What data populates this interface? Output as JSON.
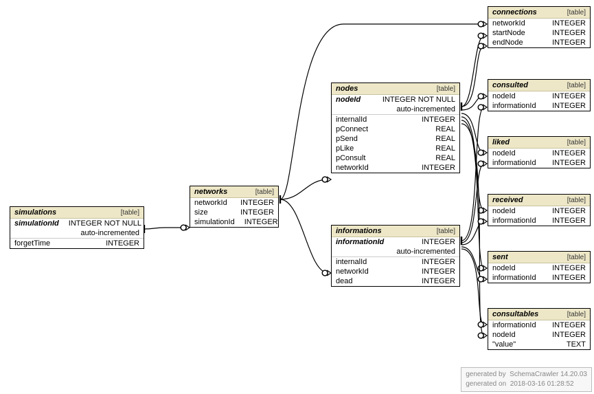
{
  "tables": {
    "simulations": {
      "name": "simulations",
      "tag": "[table]",
      "rows": [
        {
          "c1": "simulationId",
          "c2": "INTEGER NOT NULL",
          "pk": true
        },
        {
          "c1": "",
          "c2": "auto-incremented"
        },
        {
          "c1": "forgetTime",
          "c2": "INTEGER"
        }
      ]
    },
    "networks": {
      "name": "networks",
      "tag": "[table]",
      "rows": [
        {
          "c1": "networkId",
          "c2": "INTEGER"
        },
        {
          "c1": "size",
          "c2": "INTEGER"
        },
        {
          "c1": "simulationId",
          "c2": "INTEGER"
        }
      ]
    },
    "nodes": {
      "name": "nodes",
      "tag": "[table]",
      "rows": [
        {
          "c1": "nodeId",
          "c2": "INTEGER NOT NULL",
          "pk": true
        },
        {
          "c1": "",
          "c2": "auto-incremented"
        },
        {
          "c1": "internalId",
          "c2": "INTEGER"
        },
        {
          "c1": "pConnect",
          "c2": "REAL"
        },
        {
          "c1": "pSend",
          "c2": "REAL"
        },
        {
          "c1": "pLike",
          "c2": "REAL"
        },
        {
          "c1": "pConsult",
          "c2": "REAL"
        },
        {
          "c1": "networkId",
          "c2": "INTEGER"
        }
      ]
    },
    "informations": {
      "name": "informations",
      "tag": "[table]",
      "rows": [
        {
          "c1": "informationId",
          "c2": "INTEGER",
          "pk": true
        },
        {
          "c1": "",
          "c2": "auto-incremented"
        },
        {
          "c1": "internalId",
          "c2": "INTEGER"
        },
        {
          "c1": "networkId",
          "c2": "INTEGER"
        },
        {
          "c1": "dead",
          "c2": "INTEGER"
        }
      ]
    },
    "connections": {
      "name": "connections",
      "tag": "[table]",
      "rows": [
        {
          "c1": "networkId",
          "c2": "INTEGER"
        },
        {
          "c1": "startNode",
          "c2": "INTEGER"
        },
        {
          "c1": "endNode",
          "c2": "INTEGER"
        }
      ]
    },
    "consulted": {
      "name": "consulted",
      "tag": "[table]",
      "rows": [
        {
          "c1": "nodeId",
          "c2": "INTEGER"
        },
        {
          "c1": "informationId",
          "c2": "INTEGER"
        }
      ]
    },
    "liked": {
      "name": "liked",
      "tag": "[table]",
      "rows": [
        {
          "c1": "nodeId",
          "c2": "INTEGER"
        },
        {
          "c1": "informationId",
          "c2": "INTEGER"
        }
      ]
    },
    "received": {
      "name": "received",
      "tag": "[table]",
      "rows": [
        {
          "c1": "nodeId",
          "c2": "INTEGER"
        },
        {
          "c1": "informationId",
          "c2": "INTEGER"
        }
      ]
    },
    "sent": {
      "name": "sent",
      "tag": "[table]",
      "rows": [
        {
          "c1": "nodeId",
          "c2": "INTEGER"
        },
        {
          "c1": "informationId",
          "c2": "INTEGER"
        }
      ]
    },
    "consultables": {
      "name": "consultables",
      "tag": "[table]",
      "rows": [
        {
          "c1": "informationId",
          "c2": "INTEGER"
        },
        {
          "c1": "nodeId",
          "c2": "INTEGER"
        },
        {
          "c1": "\"value\"",
          "c2": "TEXT"
        }
      ]
    }
  },
  "footer": {
    "line1a": "generated by",
    "line1b": "SchemaCrawler 14.20.03",
    "line2a": "generated on",
    "line2b": "2018-03-16 01:28:52"
  },
  "chart_data": {
    "type": "diagram",
    "description": "Entity-relationship diagram produced by SchemaCrawler",
    "entities": [
      {
        "name": "simulations",
        "columns": [
          "simulationId INTEGER NOT NULL auto-incremented",
          "forgetTime INTEGER"
        ]
      },
      {
        "name": "networks",
        "columns": [
          "networkId INTEGER",
          "size INTEGER",
          "simulationId INTEGER"
        ]
      },
      {
        "name": "nodes",
        "columns": [
          "nodeId INTEGER NOT NULL auto-incremented",
          "internalId INTEGER",
          "pConnect REAL",
          "pSend REAL",
          "pLike REAL",
          "pConsult REAL",
          "networkId INTEGER"
        ]
      },
      {
        "name": "informations",
        "columns": [
          "informationId INTEGER auto-incremented",
          "internalId INTEGER",
          "networkId INTEGER",
          "dead INTEGER"
        ]
      },
      {
        "name": "connections",
        "columns": [
          "networkId INTEGER",
          "startNode INTEGER",
          "endNode INTEGER"
        ]
      },
      {
        "name": "consulted",
        "columns": [
          "nodeId INTEGER",
          "informationId INTEGER"
        ]
      },
      {
        "name": "liked",
        "columns": [
          "nodeId INTEGER",
          "informationId INTEGER"
        ]
      },
      {
        "name": "received",
        "columns": [
          "nodeId INTEGER",
          "informationId INTEGER"
        ]
      },
      {
        "name": "sent",
        "columns": [
          "nodeId INTEGER",
          "informationId INTEGER"
        ]
      },
      {
        "name": "consultables",
        "columns": [
          "informationId INTEGER",
          "nodeId INTEGER",
          "\"value\" TEXT"
        ]
      }
    ],
    "relationships": [
      {
        "from": "networks.simulationId",
        "to": "simulations.simulationId"
      },
      {
        "from": "nodes.networkId",
        "to": "networks.networkId"
      },
      {
        "from": "informations.networkId",
        "to": "networks.networkId"
      },
      {
        "from": "connections.networkId",
        "to": "networks.networkId"
      },
      {
        "from": "connections.startNode",
        "to": "nodes.nodeId"
      },
      {
        "from": "connections.endNode",
        "to": "nodes.nodeId"
      },
      {
        "from": "consulted.nodeId",
        "to": "nodes.nodeId"
      },
      {
        "from": "consulted.informationId",
        "to": "informations.informationId"
      },
      {
        "from": "liked.nodeId",
        "to": "nodes.nodeId"
      },
      {
        "from": "liked.informationId",
        "to": "informations.informationId"
      },
      {
        "from": "received.nodeId",
        "to": "nodes.nodeId"
      },
      {
        "from": "received.informationId",
        "to": "informations.informationId"
      },
      {
        "from": "sent.nodeId",
        "to": "nodes.nodeId"
      },
      {
        "from": "sent.informationId",
        "to": "informations.informationId"
      },
      {
        "from": "consultables.informationId",
        "to": "informations.informationId"
      },
      {
        "from": "consultables.nodeId",
        "to": "nodes.nodeId"
      }
    ]
  }
}
